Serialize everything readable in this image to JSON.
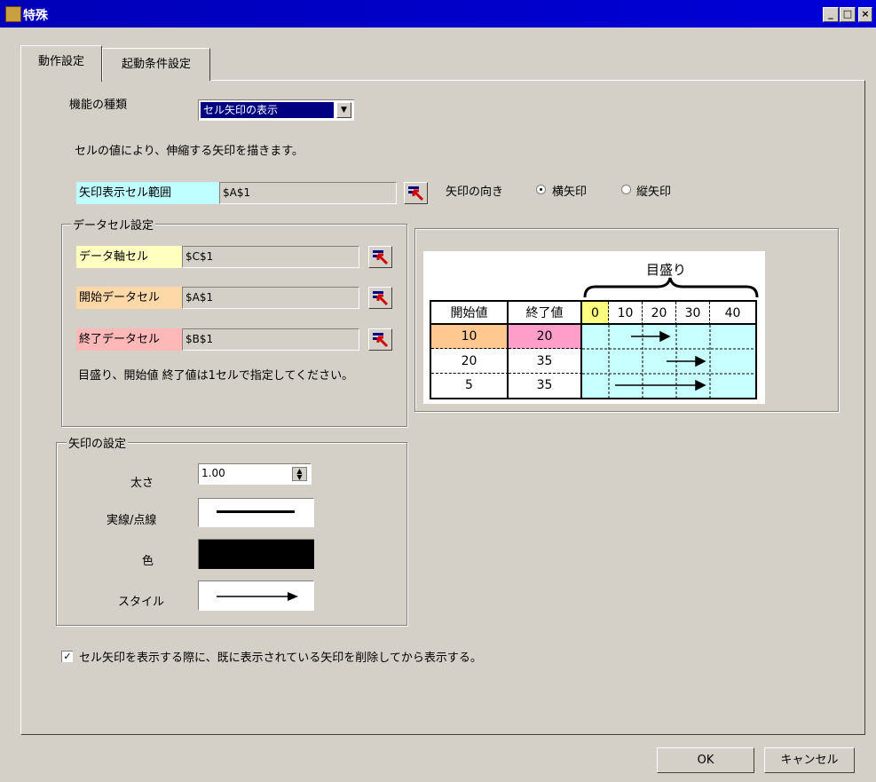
{
  "window": {
    "title": "特殊",
    "minimize": "_",
    "maximize": "□",
    "close": "×"
  },
  "tabs": [
    {
      "label": "動作設定"
    },
    {
      "label": "起動条件設定"
    }
  ],
  "function_type": {
    "label": "機能の種類",
    "selected": "セル矢印の表示"
  },
  "description": "セルの値により、伸縮する矢印を描きます。",
  "arrow_range": {
    "label": "矢印表示セル範囲",
    "value": "$A$1",
    "label_color": "#c0ffff"
  },
  "direction": {
    "label": "矢印の向き",
    "options": [
      {
        "label": "横矢印",
        "checked": true
      },
      {
        "label": "縦矢印",
        "checked": false
      }
    ]
  },
  "data_cells": {
    "title": "データセル設定",
    "rows": [
      {
        "label": "データ軸セル",
        "value": "$C$1",
        "color": "#ffffc0"
      },
      {
        "label": "開始データセル",
        "value": "$A$1",
        "color": "#ffd8a8"
      },
      {
        "label": "終了データセル",
        "value": "$B$1",
        "color": "#ffb8b8"
      }
    ],
    "note": "目盛り、開始値 終了値は1セルで指定してください。"
  },
  "example": {
    "scale_label": "目盛り",
    "headers": [
      "開始値",
      "終了値"
    ],
    "axis": [
      "0",
      "10",
      "20",
      "30",
      "40"
    ],
    "rows": [
      [
        "10",
        "20"
      ],
      [
        "20",
        "35"
      ],
      [
        "5",
        "35"
      ]
    ]
  },
  "arrow_settings": {
    "title": "矢印の設定",
    "thickness_label": "太さ",
    "thickness_value": "1.00",
    "line_label": "実線/点線",
    "color_label": "色",
    "color_value": "#000000",
    "style_label": "スタイル"
  },
  "checkbox": {
    "label": "セル矢印を表示する際に、既に表示されている矢印を削除してから表示する。",
    "checked": true
  },
  "buttons": {
    "ok": "OK",
    "cancel": "キャンセル"
  }
}
